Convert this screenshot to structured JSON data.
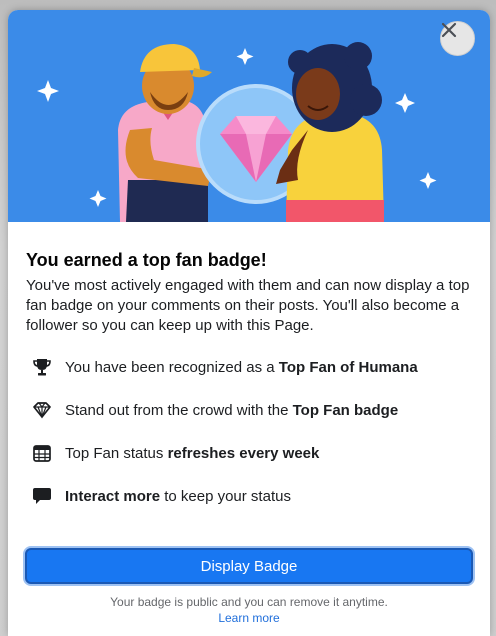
{
  "dialog": {
    "title": "You earned a top fan badge!",
    "description": "You've most actively engaged with them and can now display a top fan badge on your comments on their posts. You'll also become a follower so you can keep up with this Page.",
    "features": [
      {
        "icon": "trophy-icon",
        "pre": "You have been recognized as a ",
        "bold": "Top Fan of Humana",
        "post": ""
      },
      {
        "icon": "diamond-icon",
        "pre": "Stand out from the crowd with the ",
        "bold": "Top Fan badge",
        "post": ""
      },
      {
        "icon": "calendar-icon",
        "pre": "Top Fan status ",
        "bold": "refreshes every week",
        "post": ""
      },
      {
        "icon": "chat-bubble-icon",
        "pre": "",
        "bold": "Interact more",
        "post": " to keep your status"
      }
    ],
    "primary_button": "Display Badge",
    "footnote": "Your badge is public and you can remove it anytime.",
    "learn_more": "Learn more"
  },
  "colors": {
    "hero_bg": "#3b8be8",
    "primary": "#1877f2",
    "link": "#216fdb"
  }
}
